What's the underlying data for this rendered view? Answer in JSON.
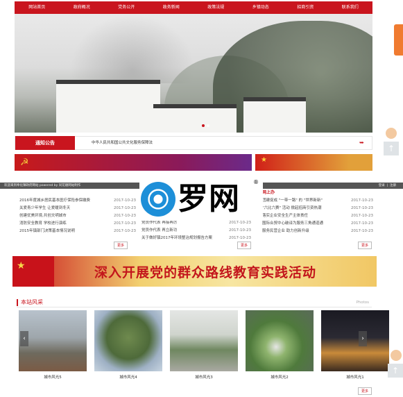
{
  "nav": {
    "items": [
      "网站首页",
      "政府概况",
      "党务公开",
      "政务新闻",
      "政策法规",
      "乡镇动态",
      "招商引资",
      "联系我们"
    ]
  },
  "notice": {
    "tag": "通知公告",
    "text": "中华人民共和国公共文化服务保障法"
  },
  "strip": {
    "left": "欢迎来到奉化镇政府网站 powered by 同花顺网站制作",
    "right_login": "登录",
    "right_register": "注册"
  },
  "columns": {
    "left": {
      "rows": [
        {
          "title": "2016年度城乡居民基本医疗保险参保缴费",
          "date": "2017-10-23"
        },
        {
          "title": "关爱青少年学生 让爱暖到冬天",
          "date": "2017-10-23"
        },
        {
          "title": "创建优美环境,共创文明城市",
          "date": "2017-10-23"
        },
        {
          "title": "消防安全教育 学校进行演练",
          "date": "2017-10-23"
        },
        {
          "title": "2015年镇部门决策基本情况说明",
          "date": "2017-10-23"
        }
      ],
      "more": "更多"
    },
    "middle": {
      "rows": [
        {
          "title": "党员作代表 再接再厉",
          "date": "2017-10-23"
        },
        {
          "title": "党员作代表 再立新功",
          "date": "2017-10-23"
        },
        {
          "title": "关于做好镇2017年环境整治规划报告方案",
          "date": "2017-10-23"
        }
      ],
      "more": "更多"
    },
    "right": {
      "head": "网上办",
      "rows": [
        {
          "title": "团建促成 \"一带一路\" 的 \"世界新新\"",
          "date": "2017-10-23"
        },
        {
          "title": "\"六比六赛\" 活动 掀起招商引资热潮",
          "date": "2017-10-23"
        },
        {
          "title": "落实企业安全生产主体责任",
          "date": "2017-10-23"
        },
        {
          "title": "围际合贸中心破译为服务三角通道通",
          "date": "2017-10-23"
        },
        {
          "title": "服务民营企业 助力创新升级",
          "date": "2017-10-23"
        }
      ],
      "more": "更多"
    }
  },
  "logo": {
    "text": "罗网",
    "reg": "®"
  },
  "banner": {
    "text": "深入开展党的群众路线教育实践活动"
  },
  "gallery": {
    "title": "本站风采",
    "subtitle": "Photos",
    "items": [
      "城市风光5",
      "城市风光4",
      "城市风光3",
      "城市风光2",
      "城市风光1"
    ],
    "more": "更多"
  },
  "colors": {
    "brand_red": "#c9151e",
    "accent_orange": "#f07b30",
    "logo_blue": "#1d8fd8"
  }
}
